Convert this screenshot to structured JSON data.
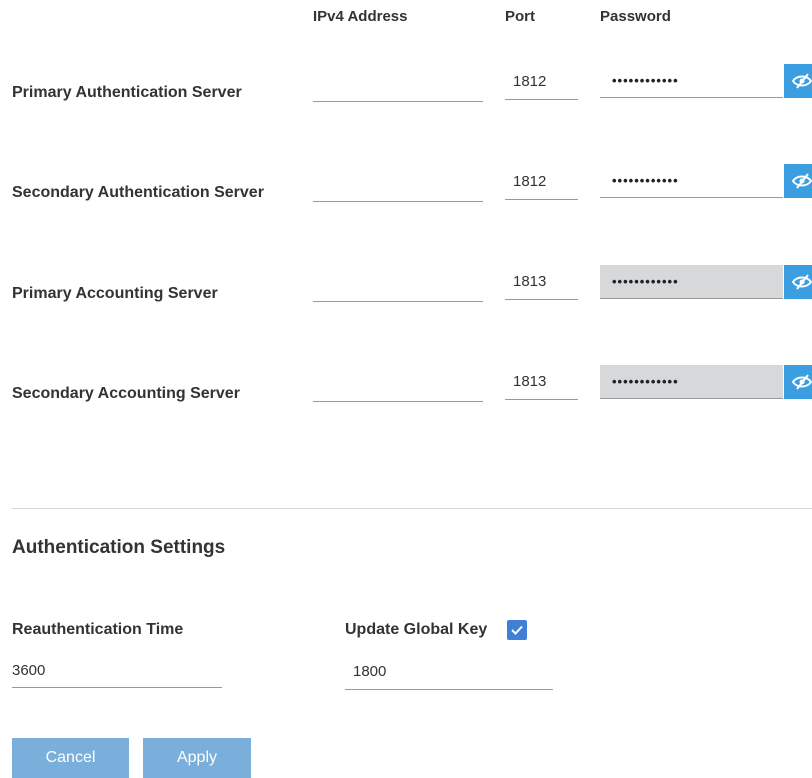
{
  "columns": {
    "ipv4": "IPv4 Address",
    "port": "Port",
    "password": "Password"
  },
  "servers": [
    {
      "label": "Primary Authentication Server",
      "ipv4": "",
      "port": "1812",
      "password": "••••••••••••",
      "password_disabled": false
    },
    {
      "label": "Secondary Authentication Server",
      "ipv4": "",
      "port": "1812",
      "password": "••••••••••••",
      "password_disabled": false
    },
    {
      "label": "Primary Accounting Server",
      "ipv4": "",
      "port": "1813",
      "password": "••••••••••••",
      "password_disabled": true
    },
    {
      "label": "Secondary Accounting Server",
      "ipv4": "",
      "port": "1813",
      "password": "••••••••••••",
      "password_disabled": true
    }
  ],
  "auth_settings": {
    "title": "Authentication Settings",
    "reauth_label": "Reauthentication Time",
    "reauth_value": "3600",
    "update_key_label": "Update Global Key",
    "update_key_checked": true,
    "update_key_value": "1800"
  },
  "buttons": {
    "cancel": "Cancel",
    "apply": "Apply"
  },
  "icons": {
    "toggle_visibility": "eye-slash-icon",
    "checkbox": "check-icon"
  },
  "colors": {
    "accent": "#3b9ee0",
    "checkbox": "#3f7fd4",
    "button": "#7aaedb",
    "disabled_field": "#d6d8da"
  }
}
